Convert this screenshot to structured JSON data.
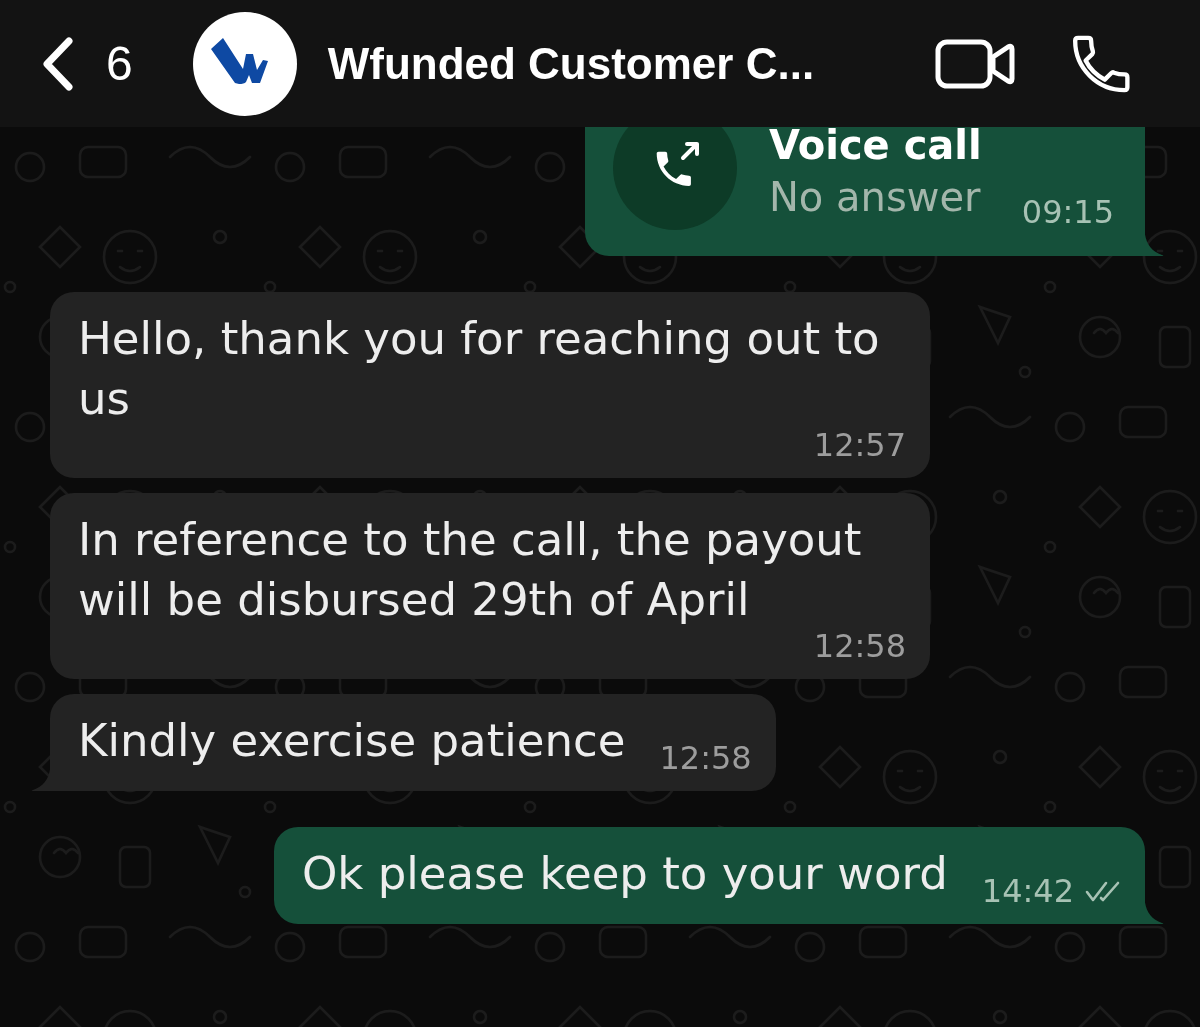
{
  "header": {
    "back_count": "6",
    "title": "Wfunded Customer C..."
  },
  "messages": [
    {
      "kind": "call",
      "outgoing": true,
      "tail": true,
      "title": "Voice call",
      "subtitle": "No answer",
      "time": "09:15"
    },
    {
      "kind": "text",
      "outgoing": false,
      "tail": false,
      "text": "Hello, thank you for reaching out to us",
      "time": "12:57"
    },
    {
      "kind": "text",
      "outgoing": false,
      "tail": false,
      "text": "In reference to the call, the payout will be disbursed 29th of April",
      "time": "12:58"
    },
    {
      "kind": "text",
      "outgoing": false,
      "tail": true,
      "text": "Kindly exercise patience",
      "time": "12:58"
    },
    {
      "kind": "text",
      "outgoing": true,
      "tail": true,
      "text": "Ok please keep to your word",
      "time": "14:42",
      "read": false
    }
  ]
}
